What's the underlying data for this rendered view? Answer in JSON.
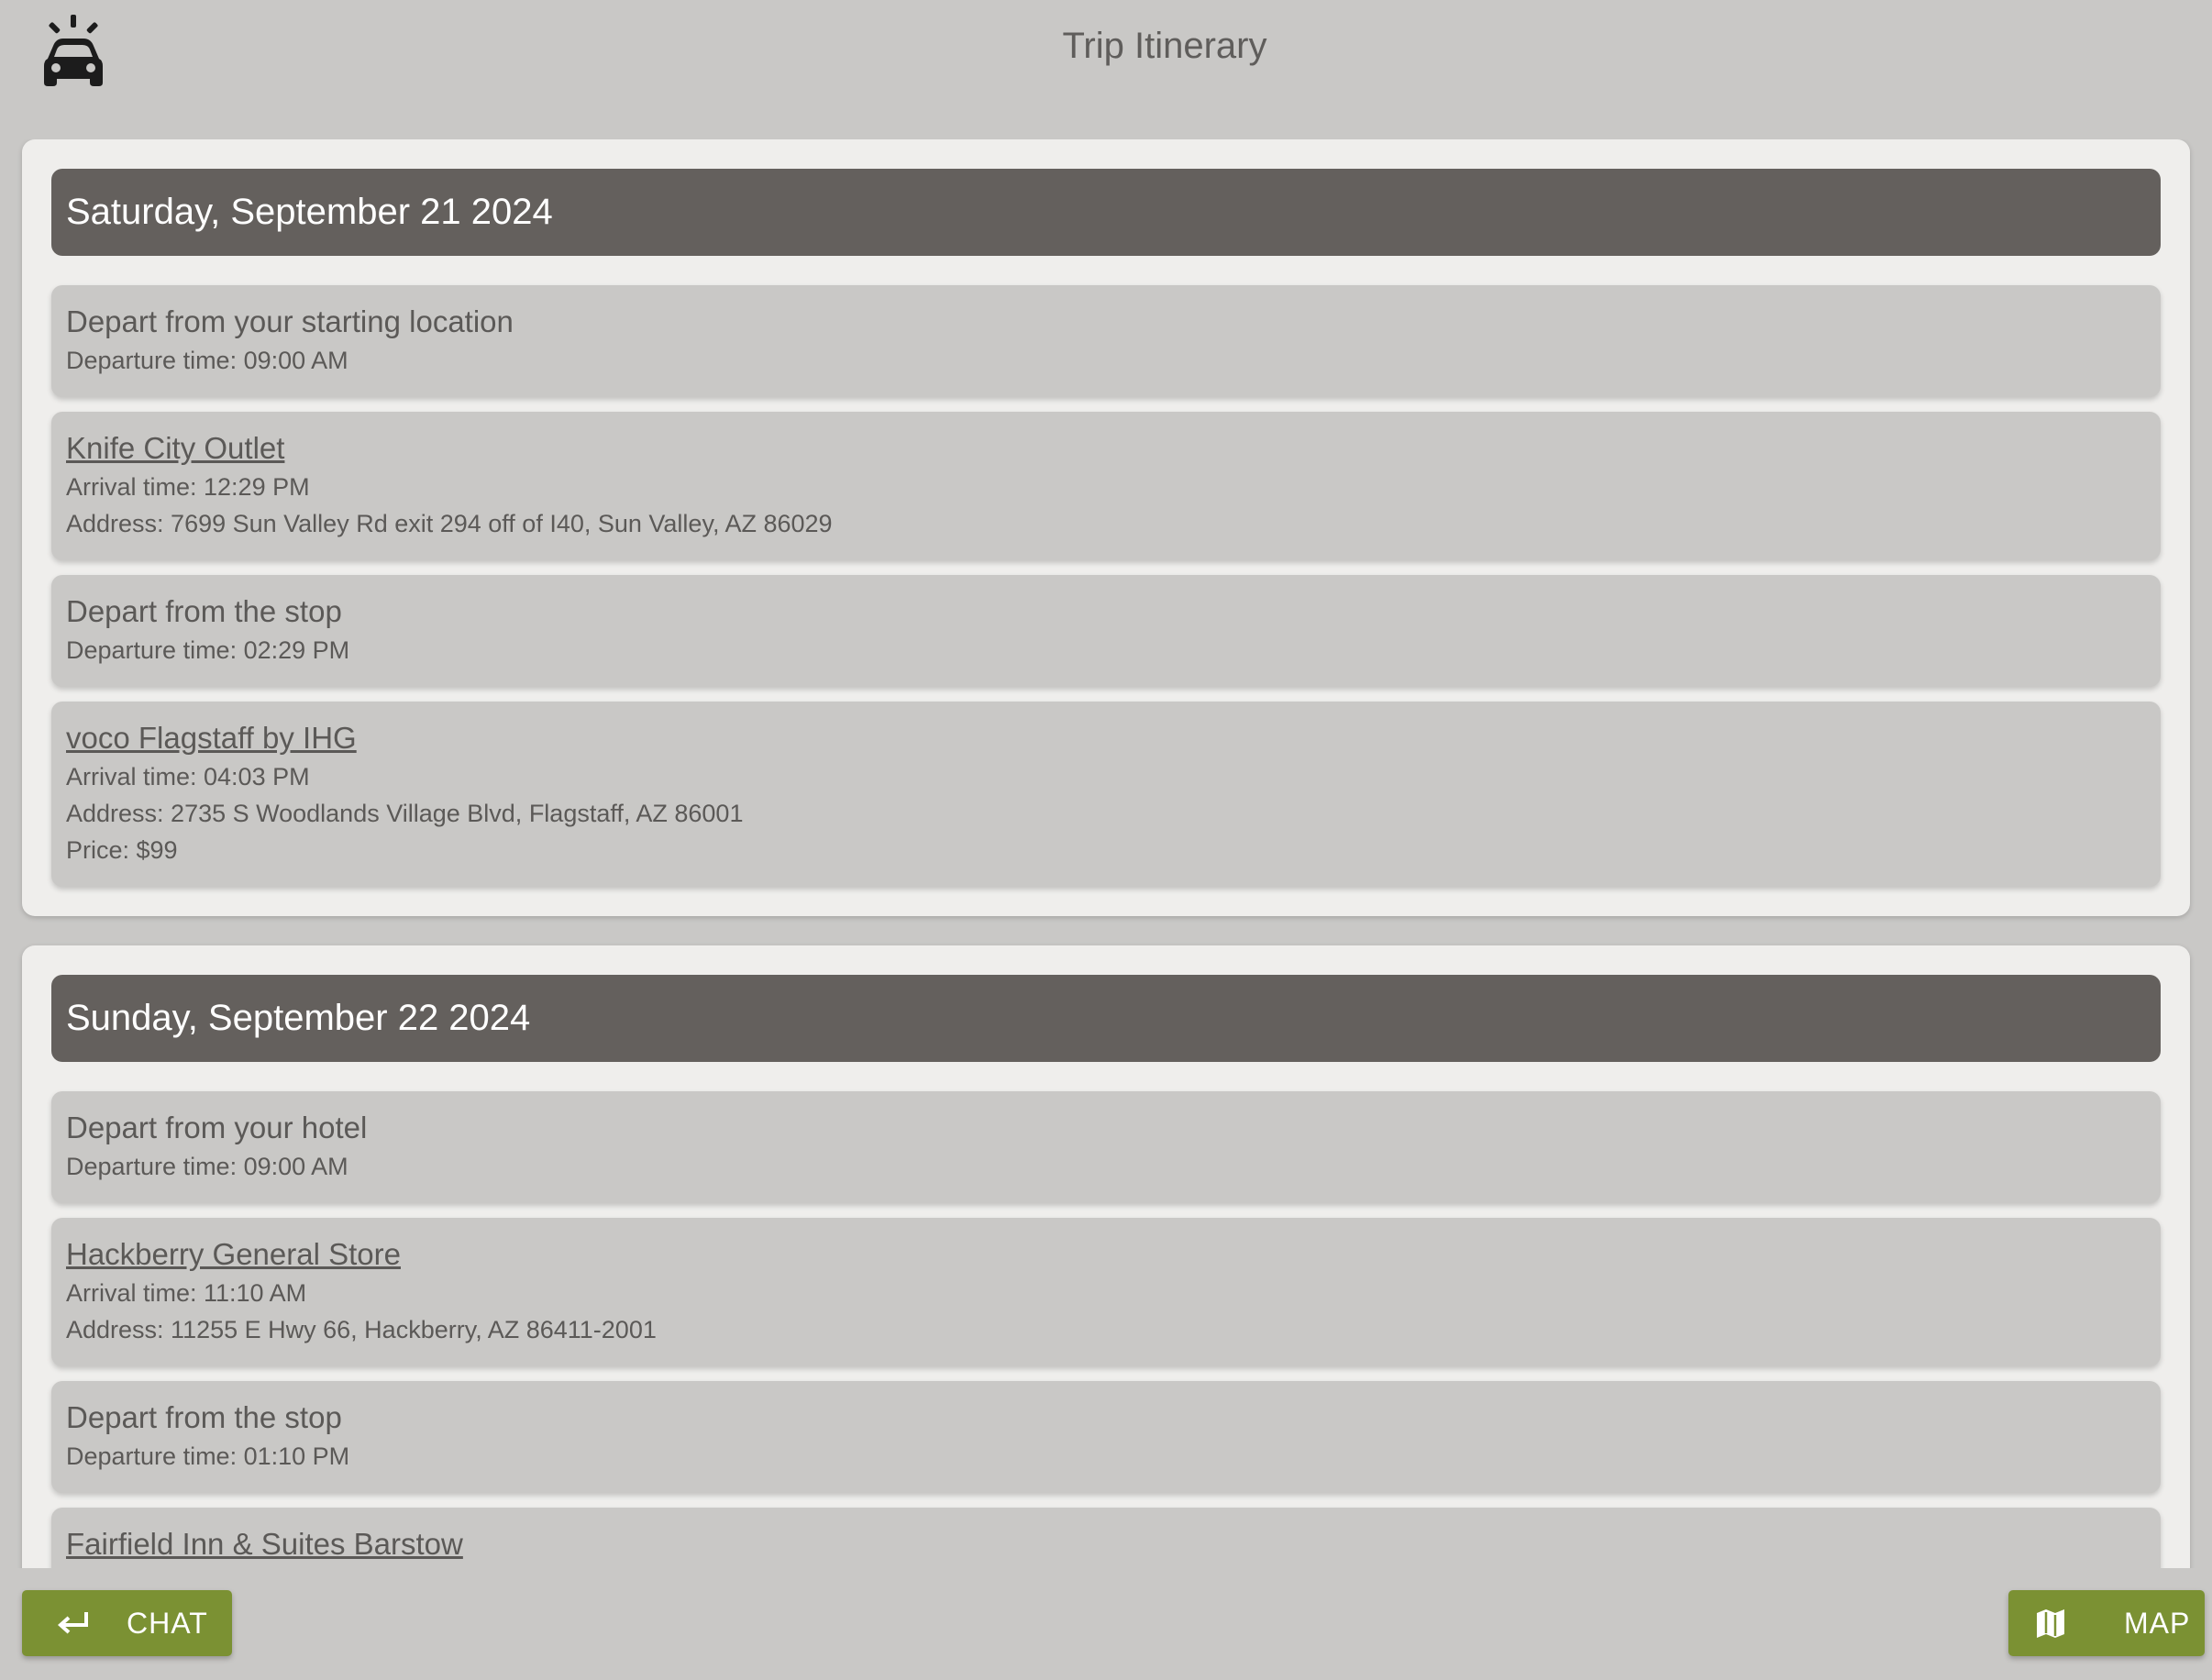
{
  "header": {
    "title": "Trip Itinerary",
    "logo_icon": "car-alert-icon"
  },
  "days": [
    {
      "date": "Saturday, September 21 2024",
      "entries": [
        {
          "title": "Depart from your starting location",
          "is_link": false,
          "lines": [
            "Departure time: 09:00 AM"
          ]
        },
        {
          "title": "Knife City Outlet",
          "is_link": true,
          "lines": [
            "Arrival time: 12:29 PM",
            "Address: 7699 Sun Valley Rd exit 294 off of I40, Sun Valley, AZ 86029"
          ]
        },
        {
          "title": "Depart from the stop",
          "is_link": false,
          "lines": [
            "Departure time: 02:29 PM"
          ]
        },
        {
          "title": "voco Flagstaff by IHG",
          "is_link": true,
          "lines": [
            "Arrival time: 04:03 PM",
            "Address: 2735 S Woodlands Village Blvd, Flagstaff, AZ 86001",
            "Price: $99"
          ]
        }
      ]
    },
    {
      "date": "Sunday, September 22 2024",
      "entries": [
        {
          "title": "Depart from your hotel",
          "is_link": false,
          "lines": [
            "Departure time: 09:00 AM"
          ]
        },
        {
          "title": "Hackberry General Store",
          "is_link": true,
          "lines": [
            "Arrival time: 11:10 AM",
            "Address: 11255 E Hwy 66, Hackberry, AZ 86411-2001"
          ]
        },
        {
          "title": "Depart from the stop",
          "is_link": false,
          "lines": [
            "Departure time: 01:10 PM"
          ]
        },
        {
          "title": "Fairfield Inn & Suites Barstow",
          "is_link": true,
          "lines": []
        }
      ]
    }
  ],
  "buttons": {
    "chat": {
      "label": "CHAT",
      "icon": "return-arrow-icon"
    },
    "map": {
      "label": "MAP",
      "icon": "map-icon"
    }
  },
  "colors": {
    "background": "#c9c8c6",
    "card": "#efeeec",
    "day_header": "#64605d",
    "accent_button": "#7b9133"
  }
}
